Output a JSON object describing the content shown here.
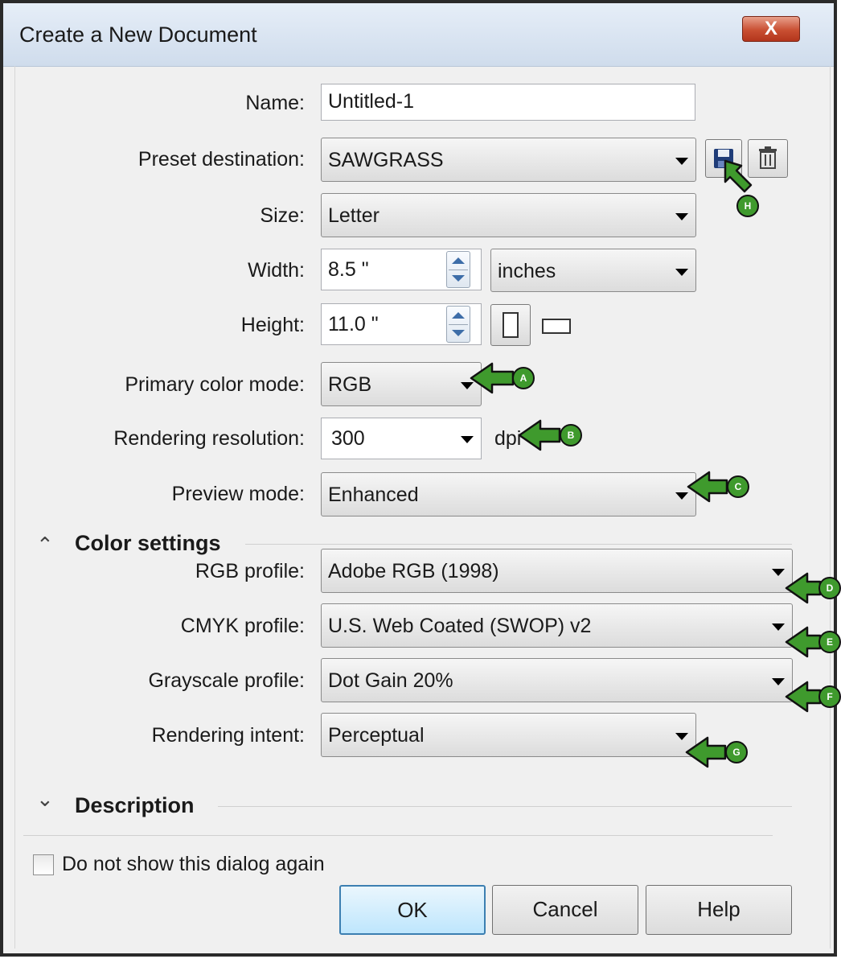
{
  "window": {
    "title": "Create a New Document",
    "close_label": "X"
  },
  "form": {
    "name": {
      "label": "Name:",
      "value": "Untitled-1"
    },
    "preset": {
      "label": "Preset destination:",
      "value": "SAWGRASS"
    },
    "size": {
      "label": "Size:",
      "value": "Letter"
    },
    "width": {
      "label": "Width:",
      "value": "8.5 \"",
      "unit": "inches"
    },
    "height": {
      "label": "Height:",
      "value": "11.0 \""
    },
    "primary_color_mode": {
      "label": "Primary color mode:",
      "value": "RGB"
    },
    "rendering_resolution": {
      "label": "Rendering resolution:",
      "value": "300",
      "unit": "dpi"
    },
    "preview_mode": {
      "label": "Preview mode:",
      "value": "Enhanced"
    }
  },
  "color_settings": {
    "title": "Color settings",
    "rgb_profile": {
      "label": "RGB profile:",
      "value": "Adobe RGB (1998)"
    },
    "cmyk_profile": {
      "label": "CMYK profile:",
      "value": "U.S. Web Coated (SWOP) v2"
    },
    "grayscale_profile": {
      "label": "Grayscale profile:",
      "value": "Dot Gain 20%"
    },
    "rendering_intent": {
      "label": "Rendering intent:",
      "value": "Perceptual"
    }
  },
  "description": {
    "title": "Description"
  },
  "footer": {
    "checkbox_label": "Do not show this dialog again",
    "checked": false,
    "ok": "OK",
    "cancel": "Cancel",
    "help": "Help"
  },
  "callouts": {
    "a": "A",
    "b": "B",
    "c": "C",
    "d": "D",
    "e": "E",
    "f": "F",
    "g": "G",
    "h": "H"
  },
  "colors": {
    "callout": "#3f9a2d",
    "default_button": "#bee6fd",
    "close_button": "#c94f32"
  },
  "icons": [
    "close-icon",
    "save-preset-icon",
    "delete-preset-icon",
    "spin-up-icon",
    "spin-down-icon",
    "portrait-icon",
    "landscape-icon",
    "collapse-section-icon",
    "expand-section-icon",
    "dropdown-arrow-icon"
  ]
}
